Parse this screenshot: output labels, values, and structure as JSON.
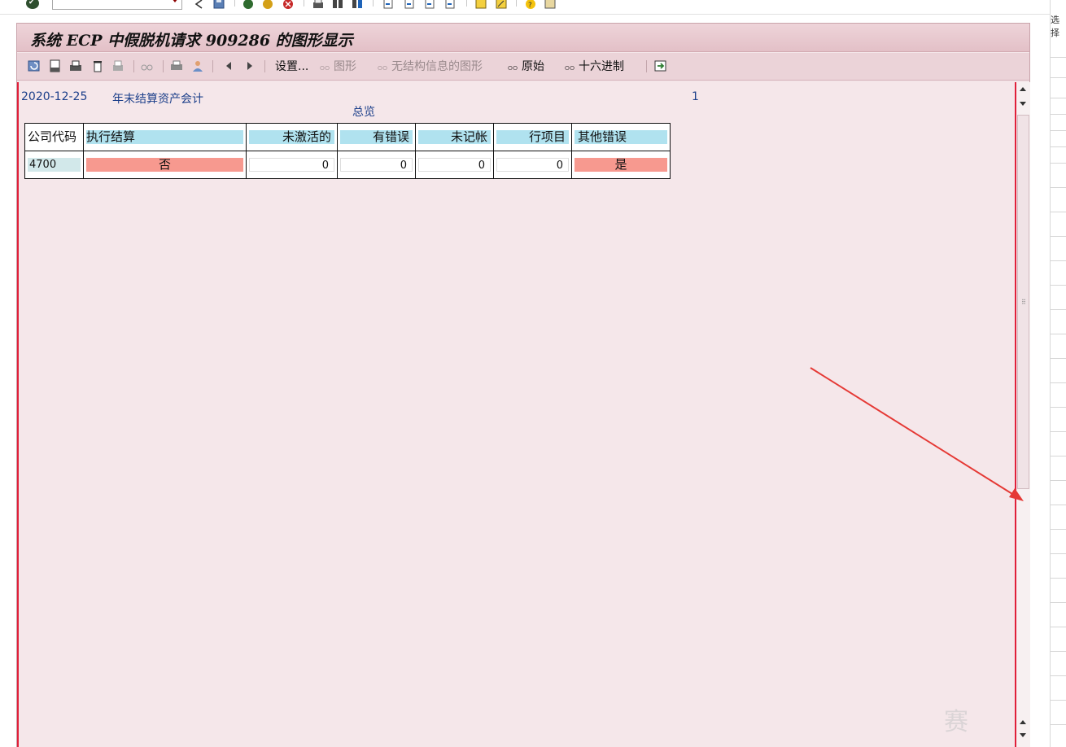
{
  "window": {
    "title": "系统 ECP 中假脱机请求 909286 的图形显示"
  },
  "toolbar": {
    "settings_label": "设置...",
    "graphic_label": "图形",
    "graphic_nostruct_label": "无结构信息的图形",
    "raw_label": "原始",
    "hex_label": "十六进制"
  },
  "report": {
    "date": "2020-12-25",
    "title": "年末结算资产会计",
    "page": "1",
    "overview": "总览"
  },
  "table": {
    "headers": [
      "公司代码",
      "执行结算",
      "未激活的",
      "有错误",
      "未记帐",
      "行项目",
      "其他错误"
    ],
    "row": {
      "company_code": "4700",
      "execute_settlement": "否",
      "inactive": "0",
      "with_errors": "0",
      "not_posted": "0",
      "line_items": "0",
      "other_errors": "是"
    }
  },
  "right_strip": {
    "text": "选择"
  },
  "colors": {
    "title_bar": "#e3c0c7",
    "content_bg": "#f5e7ea",
    "header_cell": "#b0e2ef",
    "flag_cell": "#f7998f",
    "annotation_arrow": "#e53935"
  },
  "icons": {
    "system_toolbar": [
      "ok-icon",
      "back-icon",
      "save-icon",
      "exit-icon",
      "cancel-icon",
      "print-icon",
      "find-icon",
      "find-next-icon",
      "first-page-icon",
      "prev-page-icon",
      "next-page-icon",
      "last-page-icon",
      "new-session-icon",
      "shortcut-icon",
      "help-icon",
      "layout-icon"
    ],
    "app_toolbar": [
      "refresh-icon",
      "print-icon",
      "print-immediately-icon",
      "delete-icon",
      "print-preview-icon",
      "display-icon",
      "output-controller-icon",
      "user-icon",
      "previous-icon",
      "next-icon",
      "export-icon"
    ]
  }
}
